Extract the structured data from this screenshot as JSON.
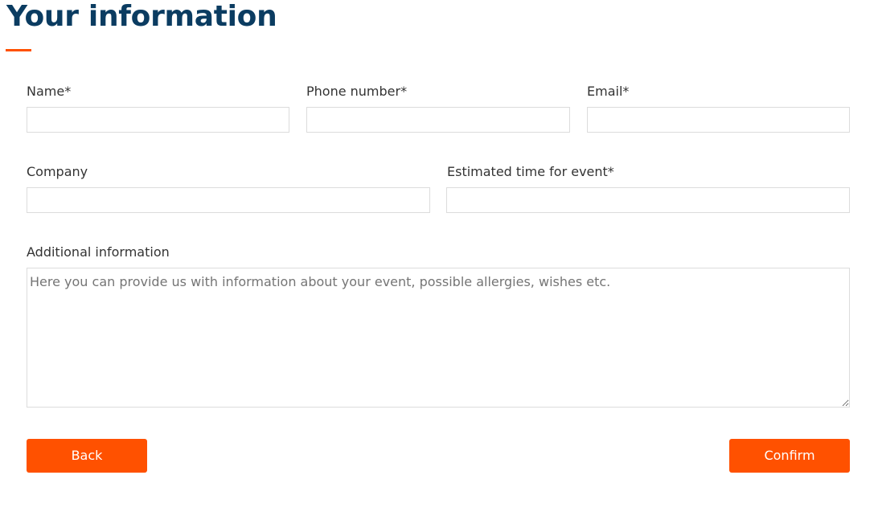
{
  "header": {
    "title": "Your information",
    "accent_color": "#ff5100",
    "title_color": "#0b3c61"
  },
  "form": {
    "name": {
      "label": "Name*",
      "value": ""
    },
    "phone": {
      "label": "Phone number*",
      "value": ""
    },
    "email": {
      "label": "Email*",
      "value": ""
    },
    "company": {
      "label": "Company",
      "value": ""
    },
    "event_time": {
      "label": "Estimated time for event*",
      "value": ""
    },
    "additional_info": {
      "label": "Additional information",
      "value": "",
      "placeholder": "Here you can provide us with information about your event, possible allergies, wishes etc."
    }
  },
  "actions": {
    "back_label": "Back",
    "confirm_label": "Confirm",
    "button_color": "#ff5100"
  }
}
